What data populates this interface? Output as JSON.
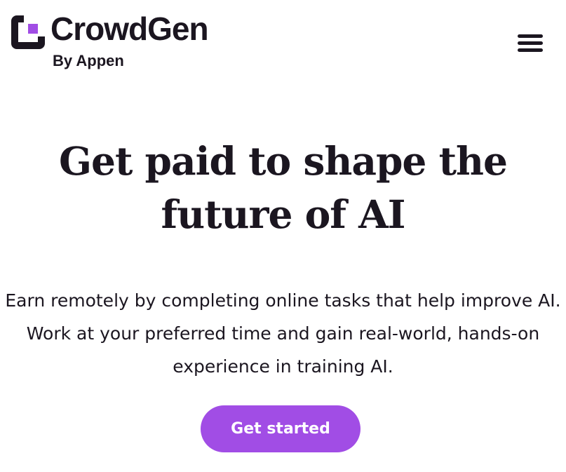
{
  "header": {
    "logo": {
      "name": "CrowdGen",
      "tagline": "By Appen",
      "mark_color": "#1b1620",
      "mark_accent_color": "#a14de5"
    },
    "menu_icon": "hamburger-menu-icon"
  },
  "hero": {
    "title_line1": "Get paid to shape the",
    "title_line2": "future of AI",
    "desc_line1": "Earn remotely by completing online tasks that help improve AI.",
    "desc_line2": "Work at your preferred time and gain real-world, hands-on",
    "desc_line3": "experience in training AI.",
    "cta_label": "Get started",
    "cta_color": "#a14de5"
  }
}
